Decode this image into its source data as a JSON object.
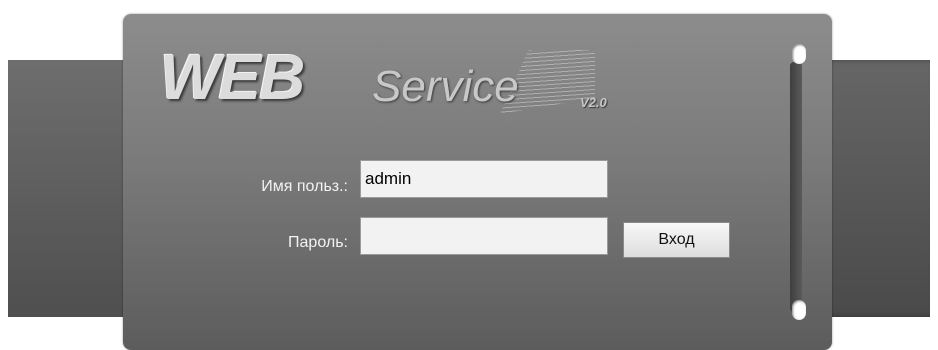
{
  "logo": {
    "web_text": "WEB",
    "service_text": "Service",
    "version_text": "V2.0"
  },
  "login_form": {
    "username_label": "Имя польз.:",
    "username_value": "admin",
    "password_label": "Пароль:",
    "password_value": "",
    "login_button_label": "Вход"
  },
  "colors": {
    "panel_top": "#8c8c8c",
    "panel_bottom": "#5c5c5c",
    "band": "#5c5c5c",
    "input_background": "#f2f2f2"
  }
}
